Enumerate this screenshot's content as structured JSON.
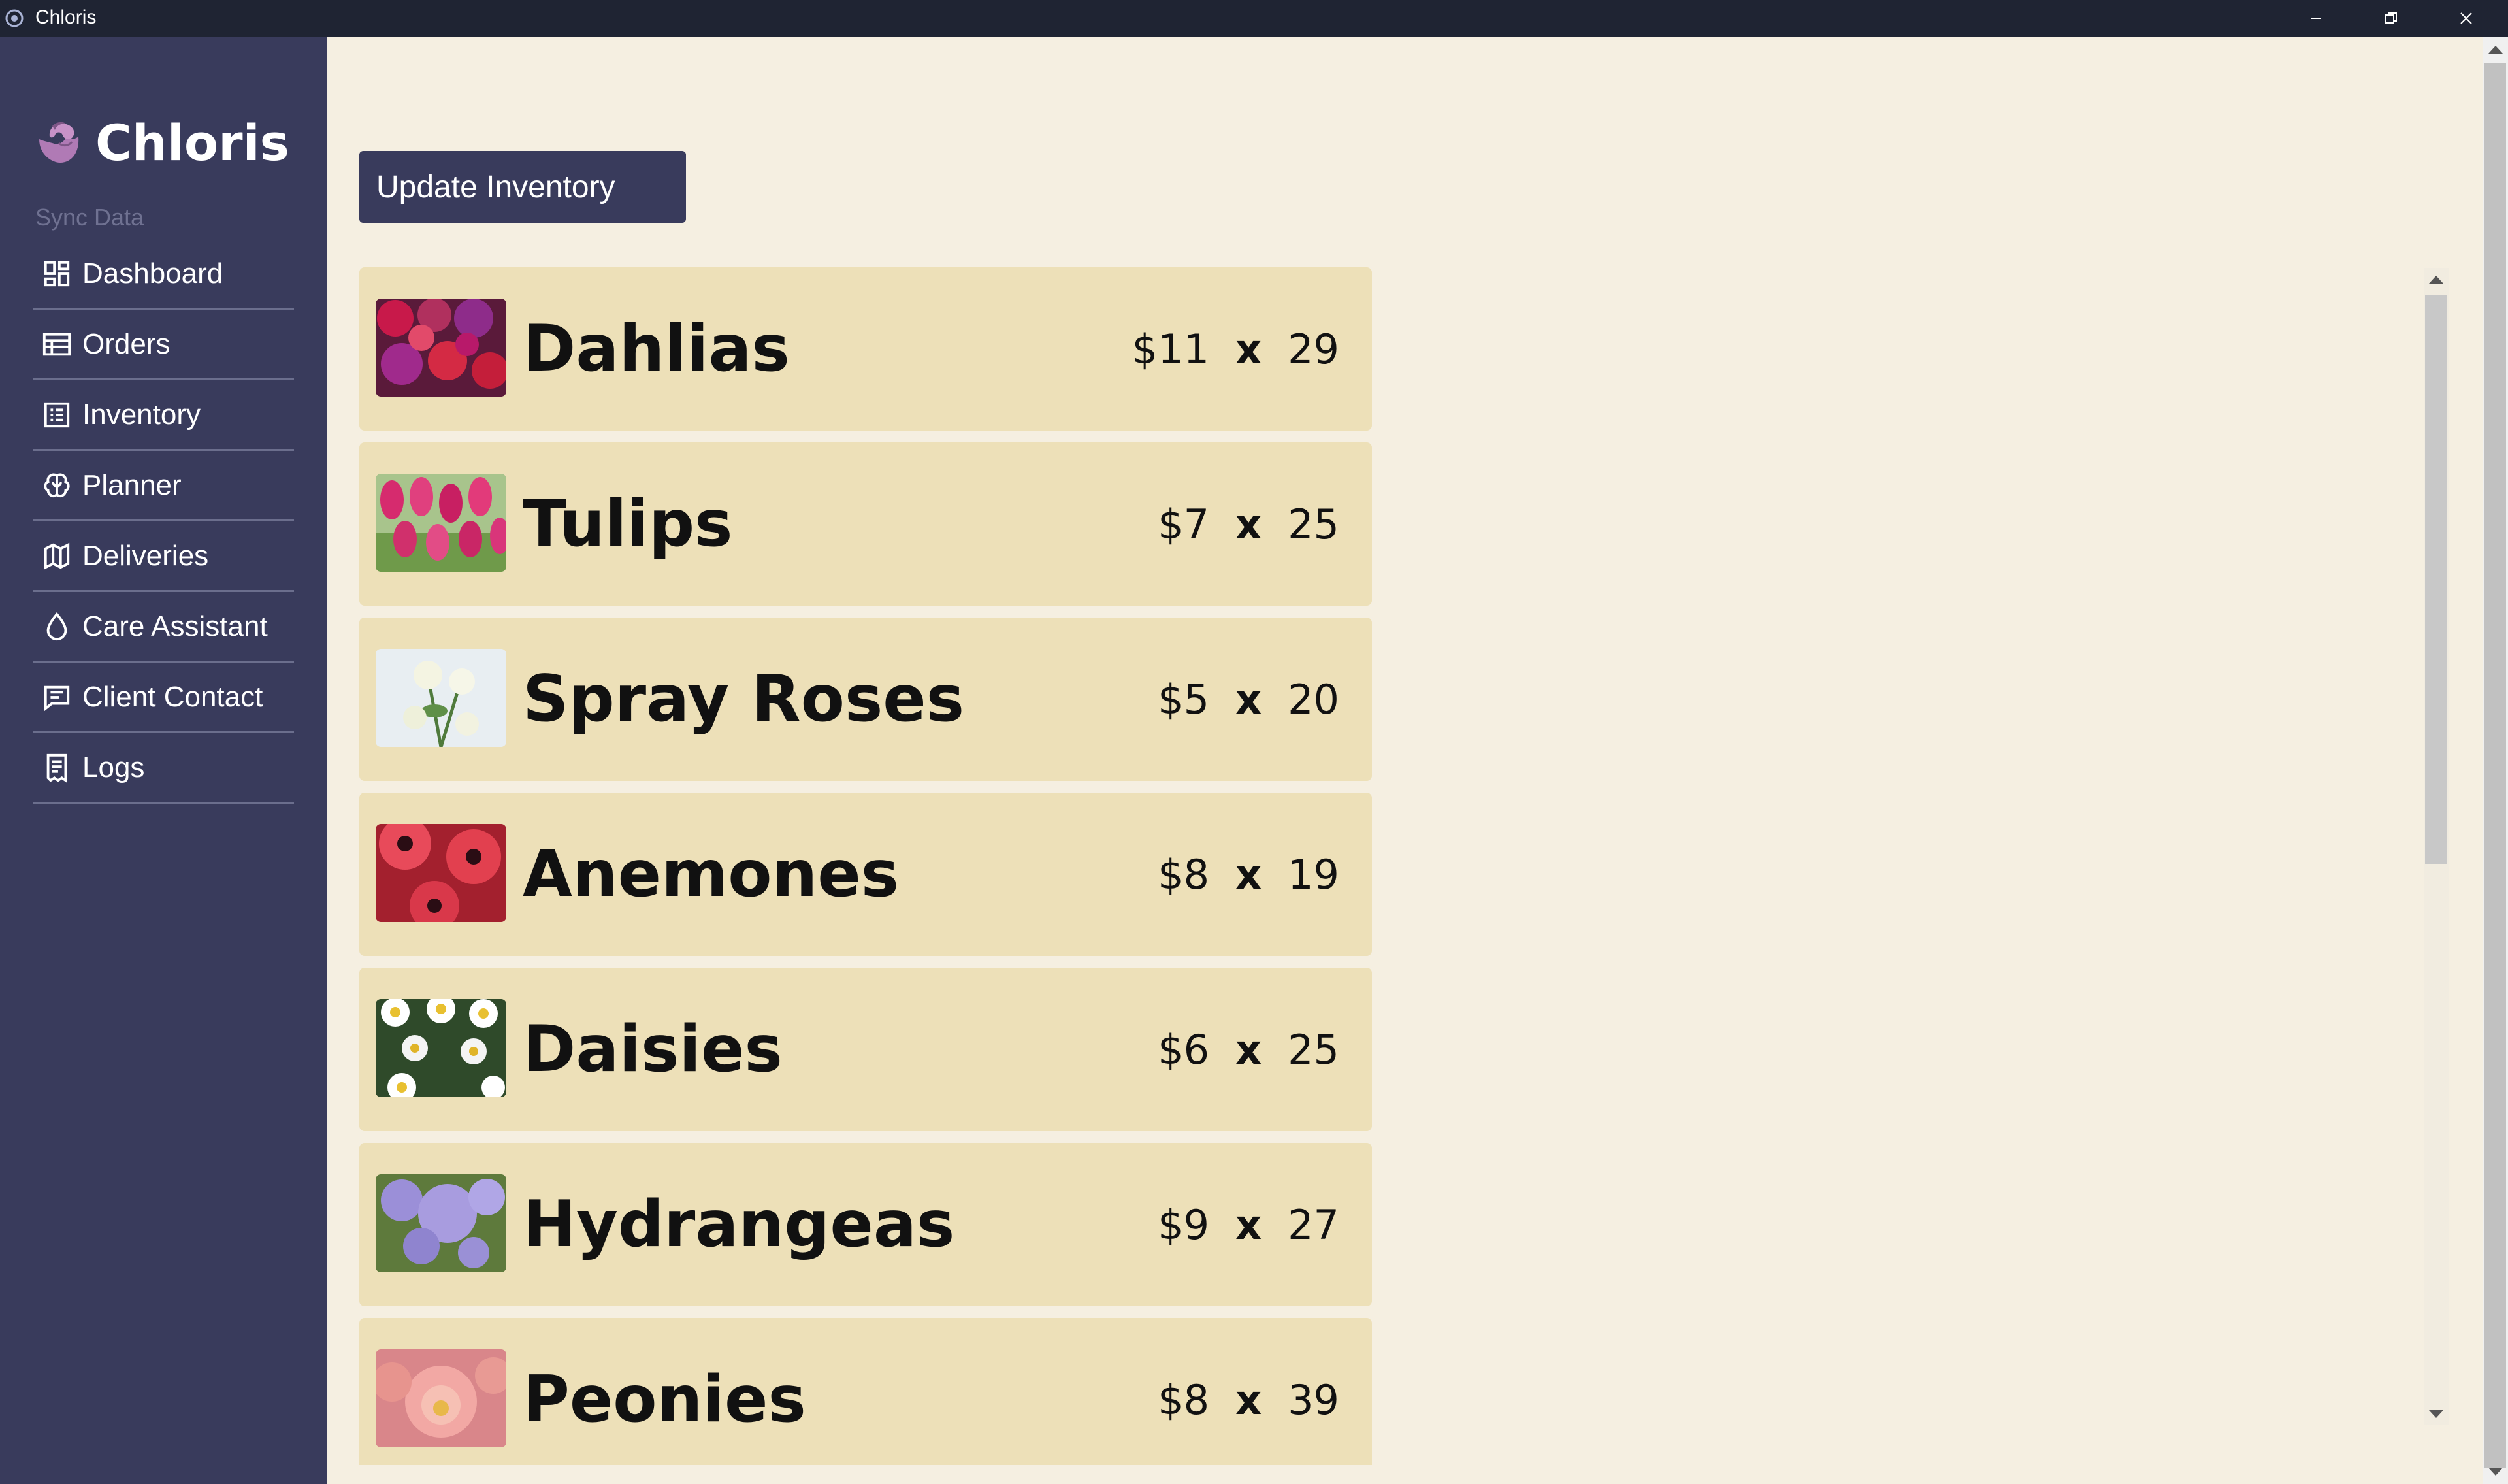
{
  "window": {
    "title": "Chloris"
  },
  "sidebar": {
    "brand": "Chloris",
    "sync_label": "Sync Data",
    "items": [
      {
        "label": "Dashboard",
        "icon": "dashboard-icon"
      },
      {
        "label": "Orders",
        "icon": "table-icon"
      },
      {
        "label": "Inventory",
        "icon": "list-icon"
      },
      {
        "label": "Planner",
        "icon": "brain-icon"
      },
      {
        "label": "Deliveries",
        "icon": "map-icon"
      },
      {
        "label": "Care Assistant",
        "icon": "droplet-icon"
      },
      {
        "label": "Client Contact",
        "icon": "message-icon"
      },
      {
        "label": "Logs",
        "icon": "receipt-icon"
      }
    ]
  },
  "main": {
    "update_button": "Update Inventory",
    "inventory": [
      {
        "name": "Dahlias",
        "price": "$11",
        "times": "x",
        "qty": "29"
      },
      {
        "name": "Tulips",
        "price": "$7",
        "times": "x",
        "qty": "25"
      },
      {
        "name": "Spray Roses",
        "price": "$5",
        "times": "x",
        "qty": "20"
      },
      {
        "name": "Anemones",
        "price": "$8",
        "times": "x",
        "qty": "19"
      },
      {
        "name": "Daisies",
        "price": "$6",
        "times": "x",
        "qty": "25"
      },
      {
        "name": "Hydrangeas",
        "price": "$9",
        "times": "x",
        "qty": "27"
      },
      {
        "name": "Peonies",
        "price": "$8",
        "times": "x",
        "qty": "39"
      }
    ]
  },
  "colors": {
    "sidebar": "#393b5c",
    "background": "#f5efe1",
    "card": "#ede0b8",
    "titlebar": "#1f2433"
  }
}
